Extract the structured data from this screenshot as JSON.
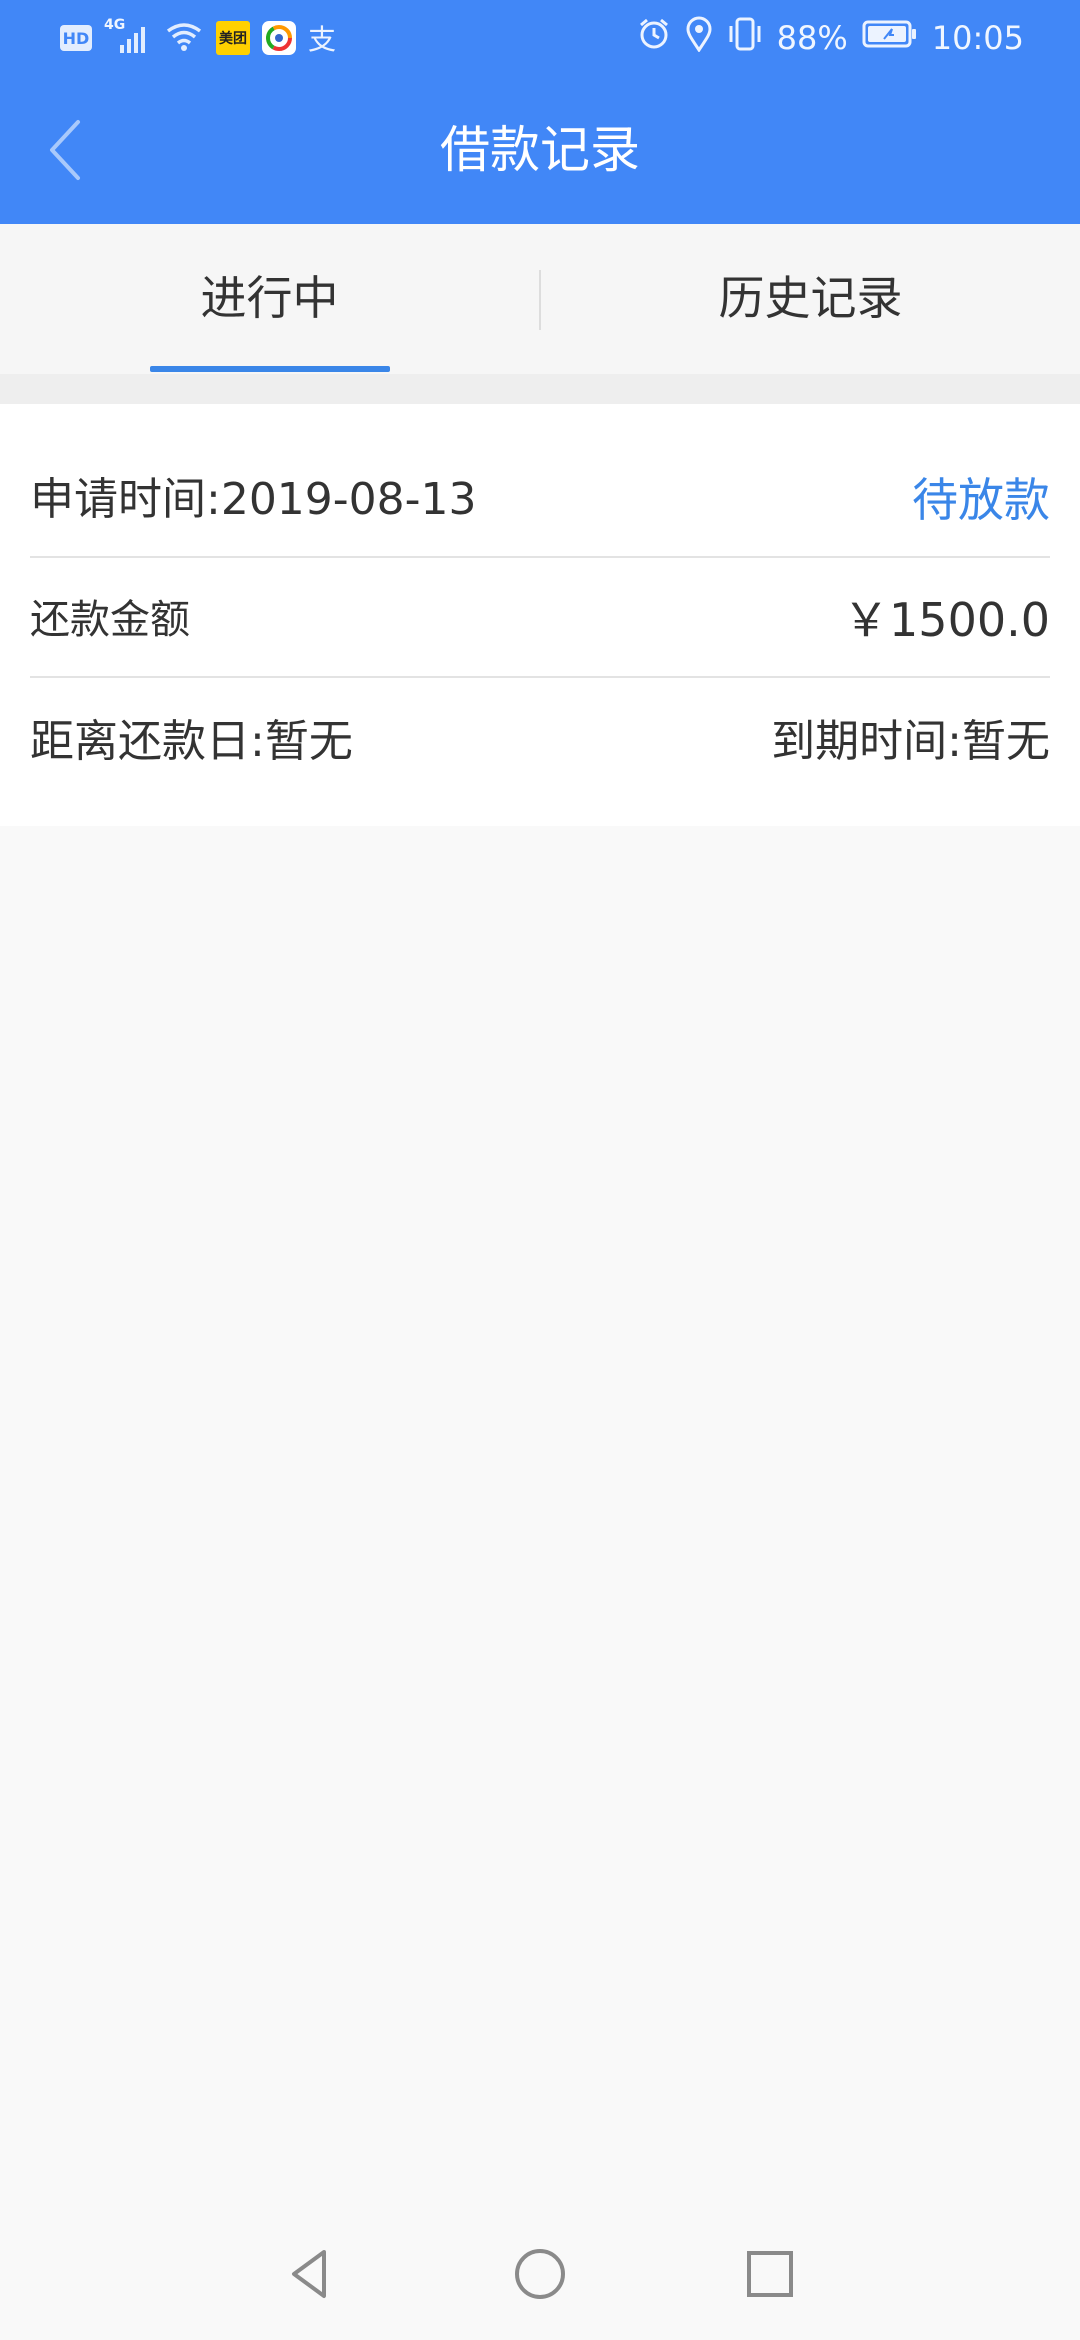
{
  "status_bar": {
    "network_badge": "HD",
    "network_type": "4G",
    "app_badge": "美团",
    "alipay_glyph": "支",
    "battery_percent": "88%",
    "time": "10:05",
    "icons": [
      "hd-icon",
      "signal-icon",
      "wifi-icon",
      "meituan-icon",
      "app-icon",
      "alipay-icon",
      "alarm-icon",
      "location-icon",
      "vibrate-icon",
      "battery-icon"
    ]
  },
  "header": {
    "title": "借款记录",
    "back_icon": "chevron-left-icon"
  },
  "tabs": [
    {
      "label": "进行中",
      "active": true
    },
    {
      "label": "历史记录",
      "active": false
    }
  ],
  "record": {
    "apply_time": "申请时间:2019-08-13",
    "status": "待放款",
    "repay_label": "还款金额",
    "repay_amount": "￥1500.0",
    "days_to_repay": "距离还款日:暂无",
    "due_time": "到期时间:暂无"
  },
  "colors": {
    "header_bg": "#4187f7",
    "accent": "#3a86e8",
    "page_bg": "#f9f9f9"
  },
  "nav_bar": {
    "icons": [
      "back-triangle-icon",
      "home-circle-icon",
      "recent-square-icon"
    ]
  }
}
